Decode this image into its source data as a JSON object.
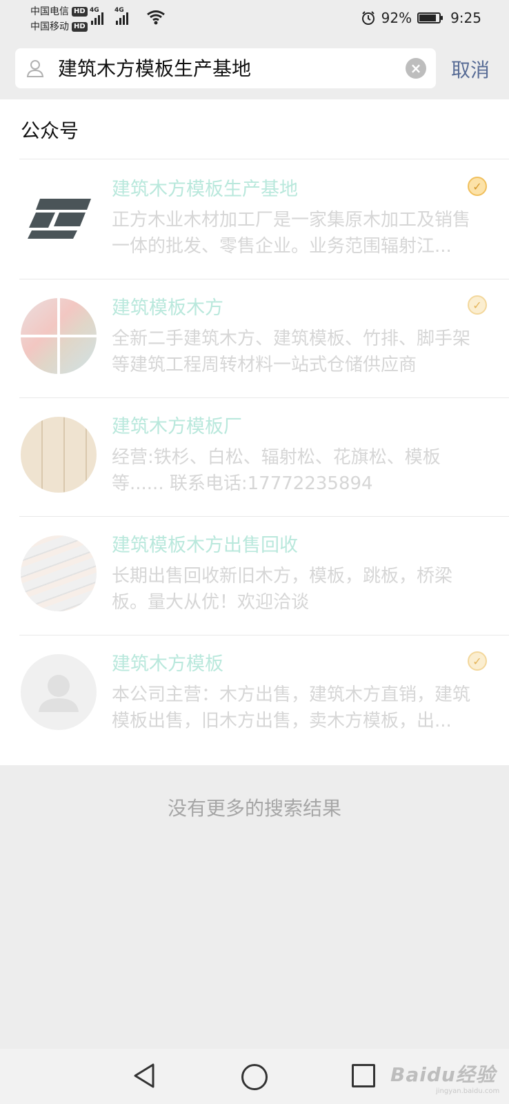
{
  "status_bar": {
    "carrier_1": "中国电信",
    "carrier_2": "中国移动",
    "hd_badge": "HD",
    "network_1": "4G",
    "network_2": "4G",
    "battery_percent": "92%",
    "battery_level": 0.92,
    "time": "9:25"
  },
  "search": {
    "query": "建筑木方模板生产基地",
    "cancel_label": "取消"
  },
  "section": {
    "title": "公众号"
  },
  "results": [
    {
      "title": "建筑木方模板生产基地",
      "description": "正方木业木材加工厂是一家集原木加工及销售一体的批发、零售企业。业务范围辐射江...",
      "verified": true
    },
    {
      "title": "建筑模板木方",
      "description": "全新二手建筑木方、建筑模板、竹排、脚手架等建筑工程周转材料一站式仓储供应商",
      "verified": true
    },
    {
      "title": "建筑木方模板厂",
      "description": "经营:铁杉、白松、辐射松、花旗松、模板等...... 联系电话:17772235894",
      "verified": false
    },
    {
      "title": "建筑模板木方出售回收",
      "description": "长期出售回收新旧木方，模板，跳板，桥梁板。量大从优！欢迎洽谈",
      "verified": false
    },
    {
      "title": "建筑木方模板",
      "description": "本公司主营：木方出售，建筑木方直销，建筑模板出售，旧木方出售，卖木方模板，出...",
      "verified": true
    }
  ],
  "footer": {
    "no_more": "没有更多的搜索结果"
  },
  "watermark": {
    "brand": "Baidu经验",
    "url": "jingyan.baidu.com"
  }
}
